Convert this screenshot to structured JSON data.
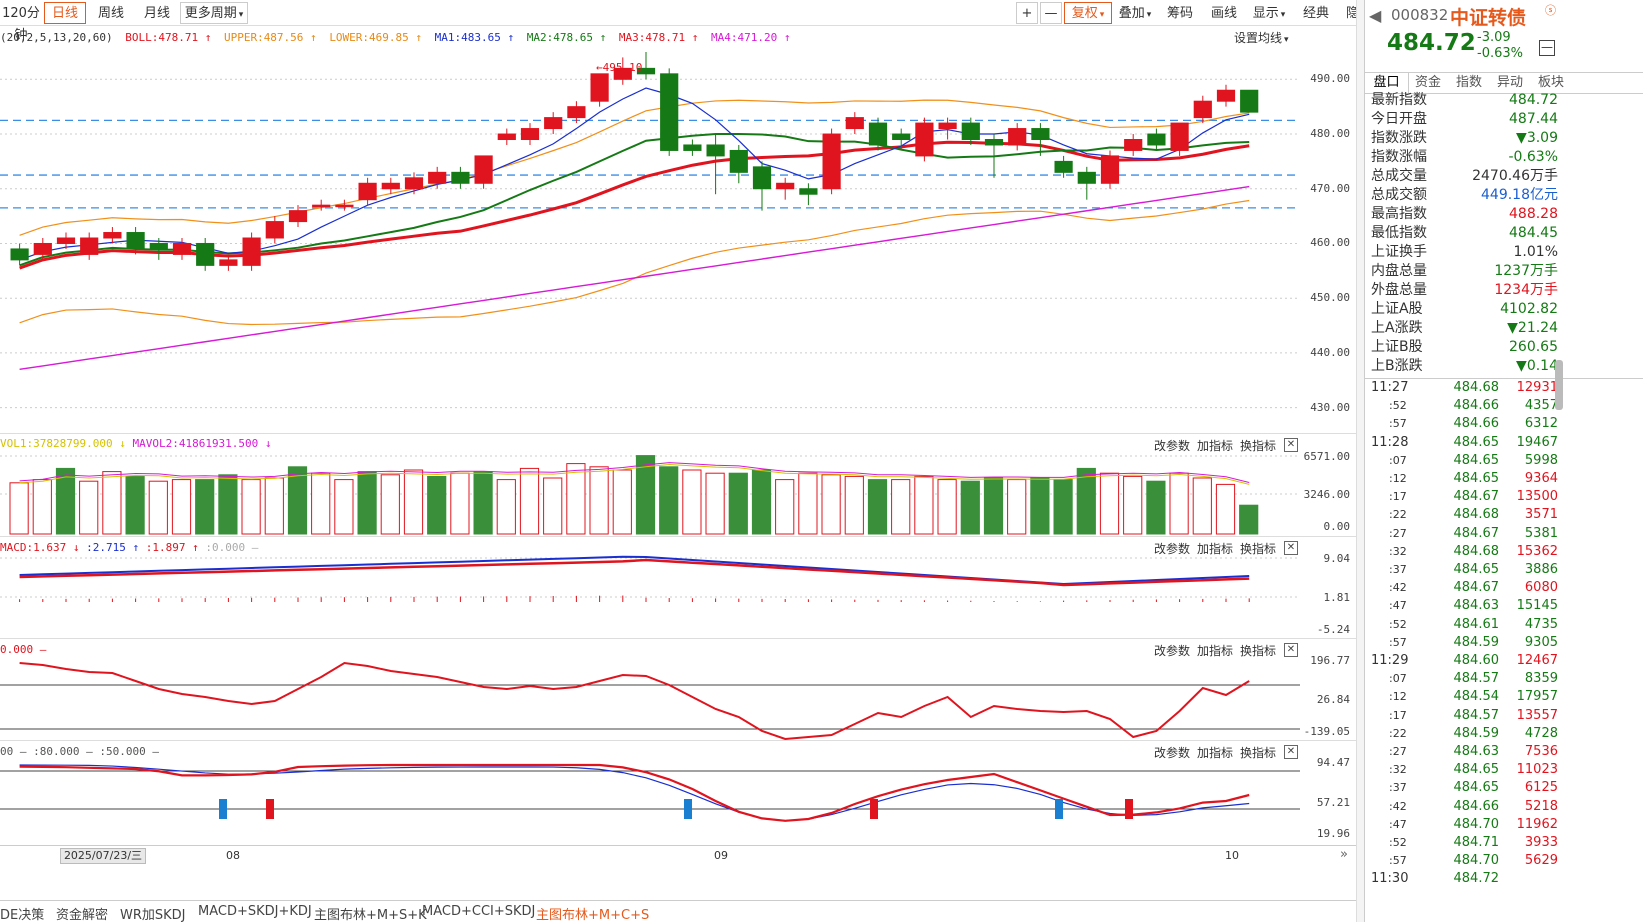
{
  "toolbar": {
    "period_120": "120分钟",
    "daily": "日线",
    "weekly": "周线",
    "monthly": "月线",
    "more_period": "更多周期",
    "plus": "+",
    "minus": "—",
    "fuquan": "复权",
    "overlay": "叠加",
    "chips": "筹码",
    "draw": "画线",
    "display": "显示",
    "classic": "经典",
    "hide": "隐藏"
  },
  "main_indicator": {
    "params": "(20,2,5,13,20,60)",
    "boll": "BOLL:478.71",
    "upper": "UPPER:487.56",
    "lower": "LOWER:469.85",
    "ma1": "MA1:483.65",
    "ma2": "MA2:478.65",
    "ma3": "MA3:478.71",
    "ma4": "MA4:471.20",
    "set_ma": "设置均线",
    "peak_label": "495.10"
  },
  "axes": {
    "main": [
      "490.00",
      "480.00",
      "470.00",
      "460.00",
      "450.00",
      "440.00",
      "430.00"
    ],
    "vol": [
      "6571.00",
      "3246.00",
      "0.00"
    ],
    "macd": [
      "9.04",
      "1.81",
      "-5.24"
    ],
    "cci": [
      "196.77",
      "26.84",
      "-139.05"
    ],
    "kdj": [
      "94.47",
      "57.21",
      "19.96"
    ]
  },
  "panels": {
    "vol_text": "VOL1:37828799.000",
    "mavol2_text": "MAVOL2:41861931.500",
    "macd_text": "MACD:1.637",
    "macd_v2": ":2.715",
    "macd_v3": ":1.897",
    "macd_v4": ":0.000",
    "cci_text": "0.000 —",
    "kdj_text": "00 — :80.000 — :50.000 —",
    "change_params": "改参数",
    "add_indicator": "加指标",
    "swap_indicator": "换指标"
  },
  "xaxis": {
    "date_box": "2025/07/23/三",
    "ticks": [
      "08",
      "09",
      "10"
    ]
  },
  "bottom_tabs": [
    "DE决策",
    "资金解密",
    "WR加SKDJ",
    "MACD+SKDJ+KDJ",
    "主图布林+M+S+K",
    "MACD+CCI+SKDJ",
    "主图布林+M+C+S"
  ],
  "right": {
    "code": "000832",
    "name": "中证转债",
    "price": "484.72",
    "change": "-3.09",
    "pct": "-0.63%",
    "tabs": [
      "盘口",
      "资金",
      "指数",
      "异动",
      "板块"
    ],
    "quote": [
      {
        "k": "最新指数",
        "v": "484.72",
        "c": "grn"
      },
      {
        "k": "今日开盘",
        "v": "487.44",
        "c": "grn"
      },
      {
        "k": "指数涨跌",
        "v": "▼3.09",
        "c": "grn"
      },
      {
        "k": "指数涨幅",
        "v": "-0.63%",
        "c": "grn"
      },
      {
        "k": "总成交量",
        "v": "2470.46万手",
        "c": "blk"
      },
      {
        "k": "总成交额",
        "v": "449.18亿元",
        "c": "blu"
      },
      {
        "k": "最高指数",
        "v": "488.28",
        "c": "red"
      },
      {
        "k": "最低指数",
        "v": "484.45",
        "c": "grn"
      },
      {
        "k": "上证换手",
        "v": "1.01%",
        "c": "blk"
      },
      {
        "k": "内盘总量",
        "v": "1237万手",
        "c": "grn"
      },
      {
        "k": "外盘总量",
        "v": "1234万手",
        "c": "red"
      },
      {
        "k": "上证A股",
        "v": "4102.82",
        "c": "grn"
      },
      {
        "k": "上A涨跌",
        "v": "▼21.24",
        "c": "grn"
      },
      {
        "k": "上证B股",
        "v": "260.65",
        "c": "grn"
      },
      {
        "k": "上B涨跌",
        "v": "▼0.14",
        "c": "grn"
      }
    ],
    "ticks": [
      {
        "t": "11:27",
        "p": "484.68",
        "q": "12931",
        "c": "red"
      },
      {
        "t": ":52",
        "p": "484.66",
        "q": "4357",
        "c": "grn"
      },
      {
        "t": ":57",
        "p": "484.66",
        "q": "6312",
        "c": "grn"
      },
      {
        "t": "11:28",
        "p": "484.65",
        "q": "19467",
        "c": "grn"
      },
      {
        "t": ":07",
        "p": "484.65",
        "q": "5998",
        "c": "grn"
      },
      {
        "t": ":12",
        "p": "484.65",
        "q": "9364",
        "c": "red"
      },
      {
        "t": ":17",
        "p": "484.67",
        "q": "13500",
        "c": "red"
      },
      {
        "t": ":22",
        "p": "484.68",
        "q": "3571",
        "c": "red"
      },
      {
        "t": ":27",
        "p": "484.67",
        "q": "5381",
        "c": "grn"
      },
      {
        "t": ":32",
        "p": "484.68",
        "q": "15362",
        "c": "red"
      },
      {
        "t": ":37",
        "p": "484.65",
        "q": "3886",
        "c": "grn"
      },
      {
        "t": ":42",
        "p": "484.67",
        "q": "6080",
        "c": "red"
      },
      {
        "t": ":47",
        "p": "484.63",
        "q": "15145",
        "c": "grn"
      },
      {
        "t": ":52",
        "p": "484.61",
        "q": "4735",
        "c": "grn"
      },
      {
        "t": ":57",
        "p": "484.59",
        "q": "9305",
        "c": "grn"
      },
      {
        "t": "11:29",
        "p": "484.60",
        "q": "12467",
        "c": "red"
      },
      {
        "t": ":07",
        "p": "484.57",
        "q": "8359",
        "c": "grn"
      },
      {
        "t": ":12",
        "p": "484.54",
        "q": "17957",
        "c": "grn"
      },
      {
        "t": ":17",
        "p": "484.57",
        "q": "13557",
        "c": "red"
      },
      {
        "t": ":22",
        "p": "484.59",
        "q": "4728",
        "c": "grn"
      },
      {
        "t": ":27",
        "p": "484.63",
        "q": "7536",
        "c": "red"
      },
      {
        "t": ":32",
        "p": "484.65",
        "q": "11023",
        "c": "red"
      },
      {
        "t": ":37",
        "p": "484.65",
        "q": "6125",
        "c": "red"
      },
      {
        "t": ":42",
        "p": "484.66",
        "q": "5218",
        "c": "red"
      },
      {
        "t": ":47",
        "p": "484.70",
        "q": "11962",
        "c": "red"
      },
      {
        "t": ":52",
        "p": "484.71",
        "q": "3933",
        "c": "red"
      },
      {
        "t": ":57",
        "p": "484.70",
        "q": "5629",
        "c": "red"
      },
      {
        "t": "11:30",
        "p": "484.72",
        "q": "",
        "c": "red"
      }
    ]
  },
  "chart_data": {
    "type": "candlestick",
    "ylim": [
      425,
      497
    ],
    "candles": [
      [
        459,
        457,
        460,
        456
      ],
      [
        458,
        460,
        461,
        457
      ],
      [
        460,
        461,
        462,
        459
      ],
      [
        458,
        461,
        462,
        457
      ],
      [
        461,
        462,
        463,
        460
      ],
      [
        462,
        459,
        463,
        458
      ],
      [
        460,
        459,
        461,
        457
      ],
      [
        458,
        460,
        461,
        457
      ],
      [
        460,
        456,
        461,
        455
      ],
      [
        456,
        457,
        458,
        455
      ],
      [
        456,
        461,
        462,
        455
      ],
      [
        461,
        464,
        465,
        460
      ],
      [
        464,
        466,
        467,
        463
      ],
      [
        467,
        467,
        468,
        466
      ],
      [
        467,
        467,
        468,
        466
      ],
      [
        468,
        471,
        472,
        467
      ],
      [
        470,
        471,
        472,
        469
      ],
      [
        470,
        472,
        473,
        469
      ],
      [
        471,
        473,
        474,
        470
      ],
      [
        473,
        471,
        474,
        470
      ],
      [
        471,
        476,
        476,
        470
      ],
      [
        479,
        480,
        481,
        478
      ],
      [
        479,
        481,
        482,
        478
      ],
      [
        481,
        483,
        484,
        480
      ],
      [
        483,
        485,
        486,
        482
      ],
      [
        486,
        491,
        491,
        485
      ],
      [
        490,
        492,
        494,
        489
      ],
      [
        492,
        491,
        495,
        490
      ],
      [
        491,
        477,
        492,
        476
      ],
      [
        478,
        477,
        479,
        476
      ],
      [
        478,
        476,
        480,
        469
      ],
      [
        477,
        473,
        478,
        471
      ],
      [
        474,
        470,
        475,
        466
      ],
      [
        470,
        471,
        472,
        468
      ],
      [
        470,
        469,
        471,
        467
      ],
      [
        470,
        480,
        481,
        469
      ],
      [
        481,
        483,
        484,
        480
      ],
      [
        482,
        478,
        483,
        477
      ],
      [
        480,
        479,
        481,
        477
      ],
      [
        476,
        482,
        483,
        475
      ],
      [
        481,
        482,
        483,
        479
      ],
      [
        482,
        479,
        483,
        478
      ],
      [
        479,
        478,
        480,
        472
      ],
      [
        478,
        481,
        482,
        477
      ],
      [
        481,
        479,
        482,
        476
      ],
      [
        475,
        473,
        476,
        472
      ],
      [
        473,
        471,
        474,
        468
      ],
      [
        471,
        476,
        477,
        470
      ],
      [
        477,
        479,
        480,
        476
      ],
      [
        480,
        478,
        481,
        477
      ],
      [
        477,
        482,
        482,
        476
      ],
      [
        483,
        486,
        487,
        482
      ],
      [
        486,
        488,
        489,
        485
      ],
      [
        488,
        484,
        488,
        484
      ]
    ],
    "volume": [
      3200,
      3400,
      4100,
      3300,
      3900,
      3600,
      3300,
      3400,
      3400,
      3700,
      3400,
      3500,
      4200,
      3800,
      3400,
      3900,
      3700,
      4000,
      3600,
      3800,
      3900,
      3400,
      4100,
      3500,
      4400,
      4200,
      4000,
      4900,
      4200,
      4000,
      3800,
      3800,
      4000,
      3400,
      3800,
      3700,
      3600,
      3400,
      3400,
      3600,
      3400,
      3300,
      3500,
      3400,
      3500,
      3400,
      4100,
      3800,
      3600,
      3300,
      3800,
      3500,
      3100,
      1800
    ],
    "vol_up": [
      1,
      1,
      0,
      1,
      1,
      0,
      1,
      1,
      0,
      0,
      1,
      1,
      0,
      1,
      1,
      0,
      1,
      1,
      0,
      1,
      0,
      1,
      1,
      1,
      1,
      1,
      1,
      0,
      0,
      1,
      1,
      0,
      0,
      1,
      1,
      1,
      1,
      0,
      1,
      1,
      1,
      0,
      0,
      1,
      0,
      0,
      0,
      1,
      1,
      0,
      1,
      1,
      1,
      0
    ]
  }
}
